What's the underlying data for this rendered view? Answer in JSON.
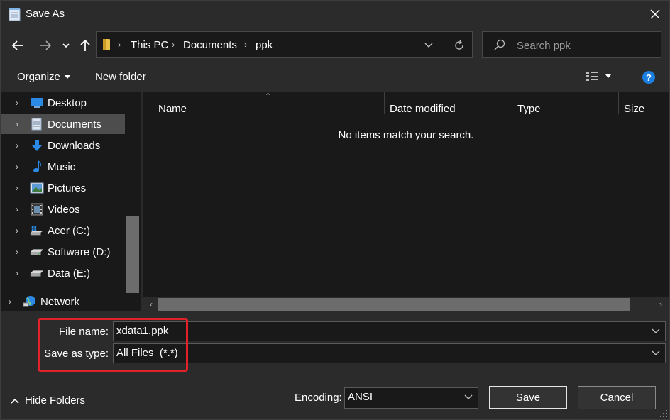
{
  "window": {
    "title": "Save As"
  },
  "addressbar": {
    "crumbs": [
      "This PC",
      "Documents",
      "ppk"
    ]
  },
  "search": {
    "placeholder": "Search ppk"
  },
  "toolbar": {
    "organize_label": "Organize",
    "new_folder_label": "New folder",
    "help_label": "?"
  },
  "navpane": {
    "items": [
      {
        "label": "Desktop",
        "icon": "desktop-icon",
        "selected": false
      },
      {
        "label": "Documents",
        "icon": "documents-icon",
        "selected": true
      },
      {
        "label": "Downloads",
        "icon": "downloads-icon",
        "selected": false
      },
      {
        "label": "Music",
        "icon": "music-icon",
        "selected": false
      },
      {
        "label": "Pictures",
        "icon": "pictures-icon",
        "selected": false
      },
      {
        "label": "Videos",
        "icon": "videos-icon",
        "selected": false
      },
      {
        "label": "Acer (C:)",
        "icon": "drive-c-icon",
        "selected": false
      },
      {
        "label": "Software (D:)",
        "icon": "drive-icon",
        "selected": false
      },
      {
        "label": "Data (E:)",
        "icon": "drive-icon",
        "selected": false
      }
    ],
    "network_label": "Network"
  },
  "content": {
    "columns": [
      "Name",
      "Date modified",
      "Type",
      "Size"
    ],
    "empty_message": "No items match your search."
  },
  "form": {
    "file_name_label": "File name:",
    "file_name_value": "xdata1.ppk",
    "save_as_type_label": "Save as type:",
    "save_as_type_value": "All Files  (*.*)"
  },
  "footer": {
    "hide_folders_label": "Hide Folders",
    "encoding_label": "Encoding:",
    "encoding_value": "ANSI",
    "save_label": "Save",
    "cancel_label": "Cancel"
  },
  "colors": {
    "background": "#2b2b2b",
    "pane": "#191919",
    "selected": "#4d4d4d",
    "highlight_box": "#e3212b",
    "help_blue": "#1a7fe0",
    "folder_yellow": "#e8c04a"
  }
}
